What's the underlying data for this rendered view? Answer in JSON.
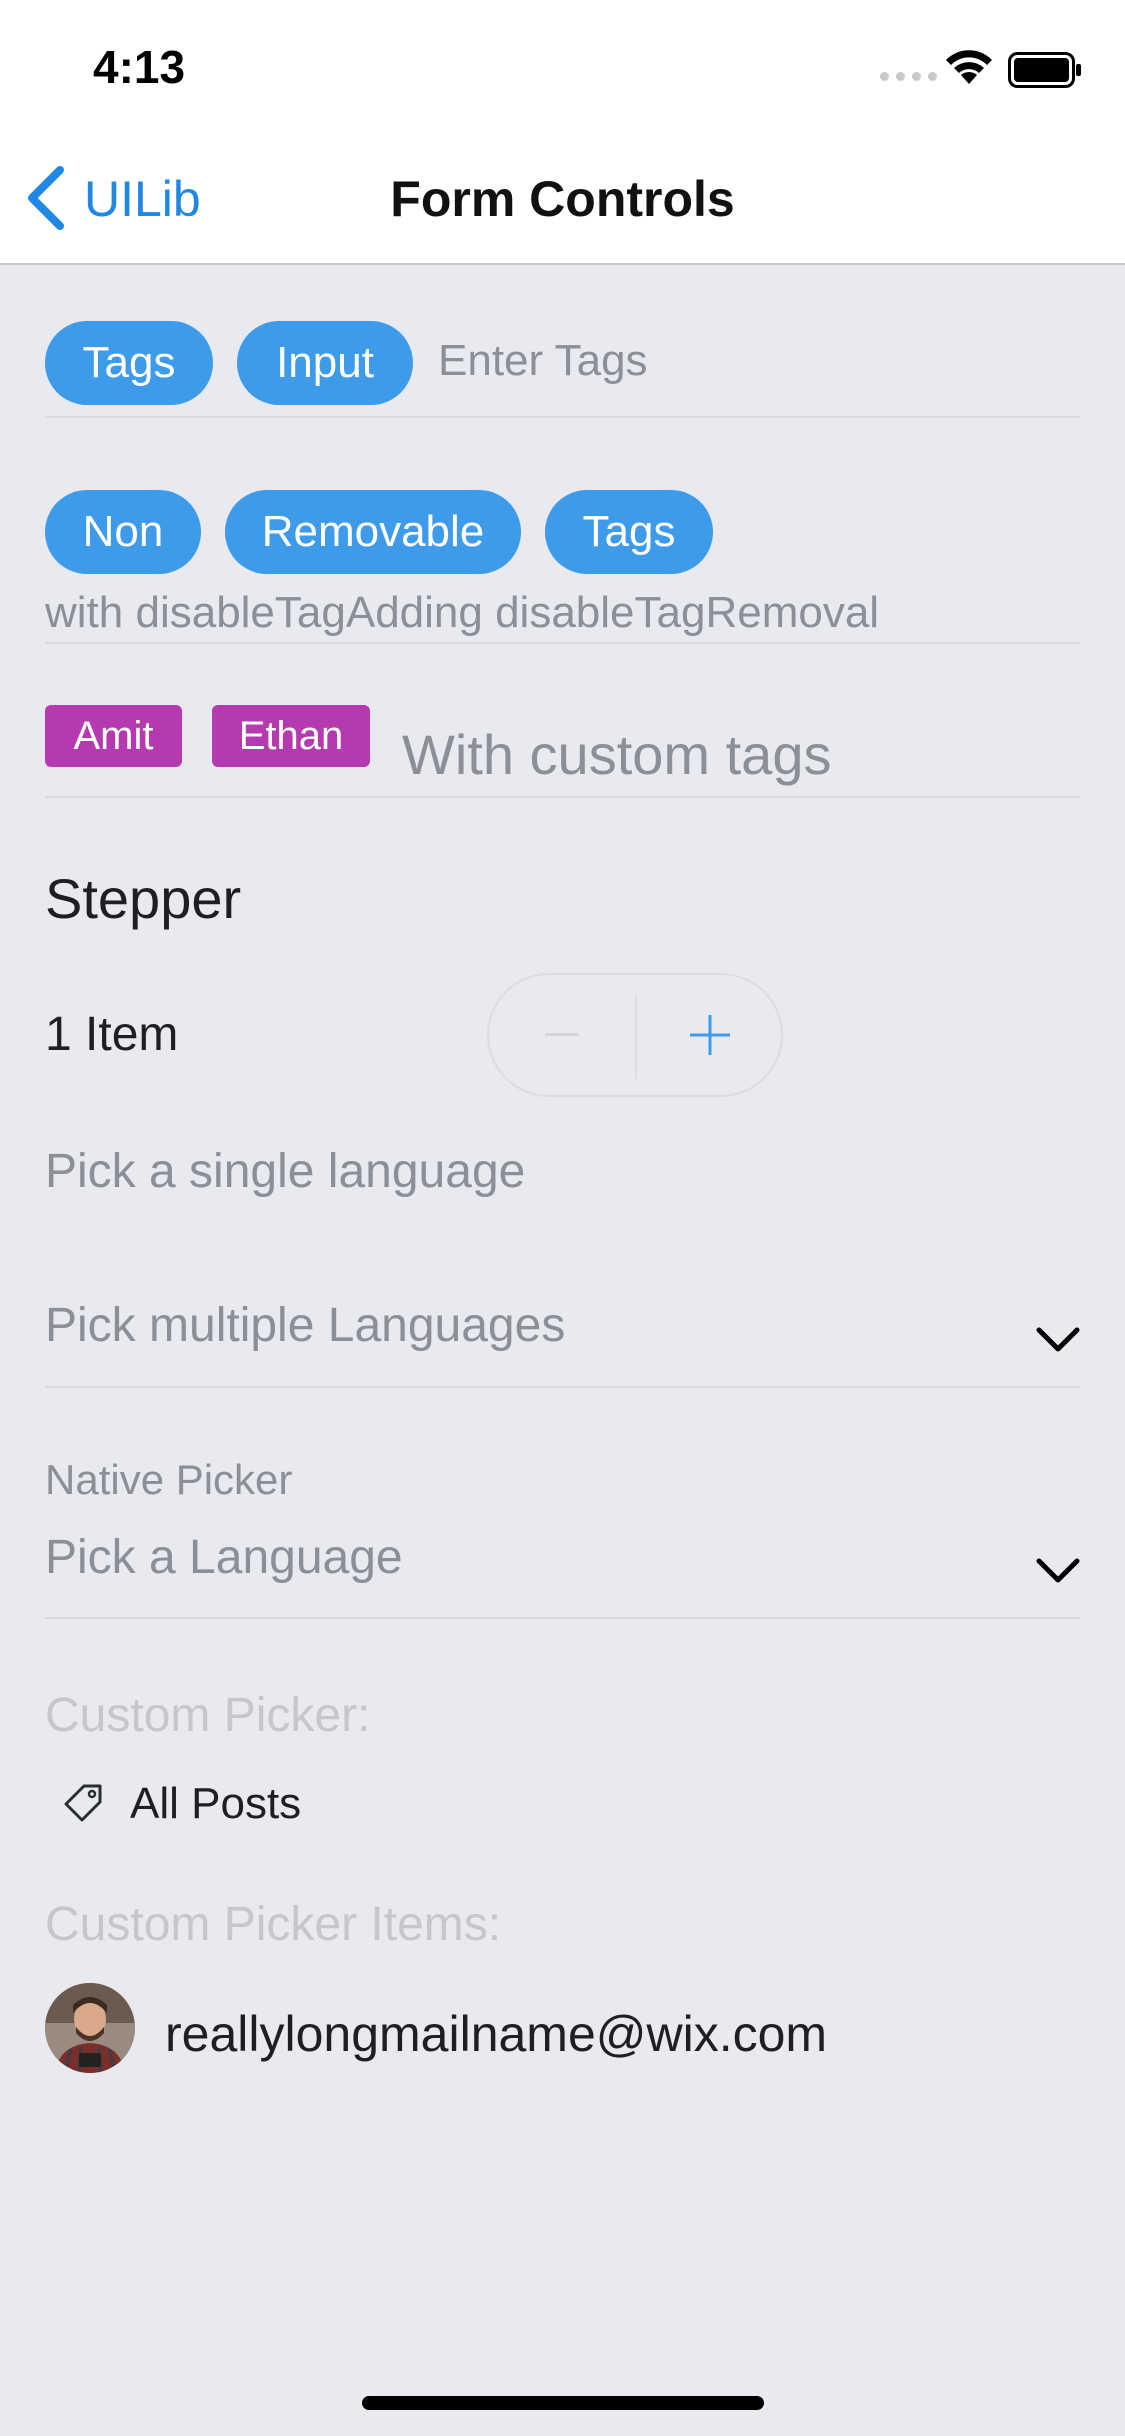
{
  "status_bar": {
    "time": "4:13"
  },
  "nav": {
    "back_label": "UILib",
    "title": "Form Controls"
  },
  "tags_input": {
    "chips": [
      "Tags",
      "Input"
    ],
    "placeholder": "Enter Tags"
  },
  "non_removable": {
    "chips": [
      "Non",
      "Removable",
      "Tags"
    ],
    "caption": "with disableTagAdding disableTagRemoval"
  },
  "custom_tags": {
    "chips": [
      "Amit",
      "Ethan"
    ],
    "placeholder": "With custom tags",
    "chip_color": "#b53ab0"
  },
  "stepper": {
    "title": "Stepper",
    "value_label": "1 Item",
    "value": 1
  },
  "single_language": {
    "placeholder": "Pick a single language"
  },
  "multi_language": {
    "placeholder": "Pick multiple Languages"
  },
  "native_picker": {
    "label": "Native Picker",
    "placeholder": "Pick a Language"
  },
  "custom_picker": {
    "label": "Custom Picker:",
    "value": "All Posts",
    "icon": "tag-icon"
  },
  "custom_picker_items": {
    "label": "Custom Picker Items:",
    "email": "reallylongmailname@wix.com"
  },
  "colors": {
    "accent": "#3d9be9",
    "link": "#1f88e5",
    "background": "#e9e9f0"
  }
}
